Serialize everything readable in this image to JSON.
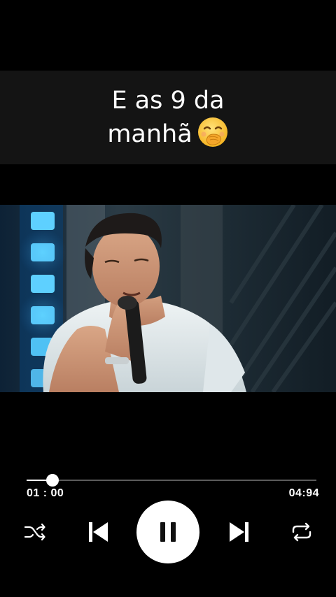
{
  "caption": {
    "line1": "E as 9 da",
    "line2": "manhã",
    "emoji": "hand-over-mouth-face-emoji"
  },
  "video": {
    "scene": "singer-with-microphone-on-stage"
  },
  "player": {
    "elapsed": "01 : 00",
    "total": "04:94",
    "progress_fraction": 0.09,
    "controls": {
      "shuffle_icon": "shuffle-icon",
      "previous_icon": "skip-previous-icon",
      "play_pause_icon": "pause-icon",
      "next_icon": "skip-next-icon",
      "repeat_icon": "repeat-icon"
    }
  },
  "colors": {
    "background": "#000000",
    "caption_band": "#141414",
    "track": "#5b5b5b",
    "accent": "#ffffff"
  }
}
